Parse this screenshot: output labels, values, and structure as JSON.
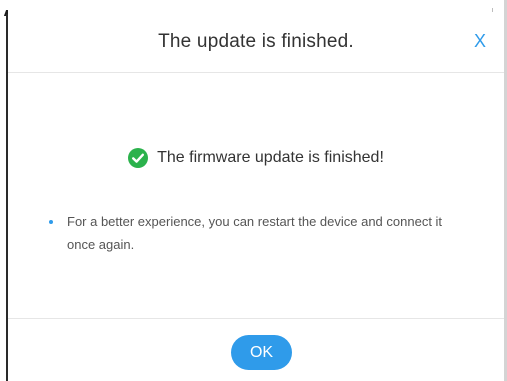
{
  "dialog": {
    "title": "The update is finished.",
    "close_label": "X",
    "message": "The firmware update is finished!",
    "tip": "For a better experience, you can restart the device and connect it once again.",
    "ok_label": "OK"
  },
  "colors": {
    "accent": "#2f9bea",
    "success": "#2bb24c",
    "text": "#333333"
  },
  "icons": {
    "status": "check-circle-icon",
    "close": "close-icon"
  }
}
